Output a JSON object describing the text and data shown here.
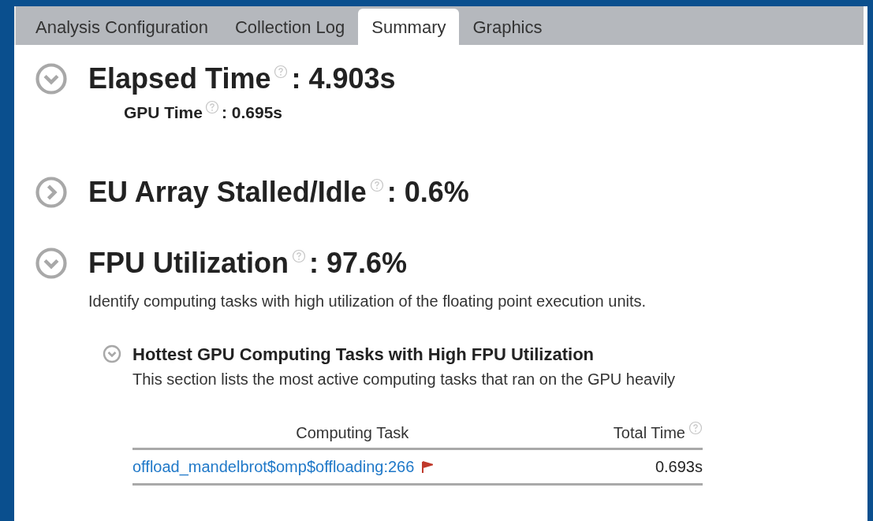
{
  "tabs": [
    {
      "label": "Analysis Configuration",
      "selected": false
    },
    {
      "label": "Collection Log",
      "selected": false
    },
    {
      "label": "Summary",
      "selected": true
    },
    {
      "label": "Graphics",
      "selected": false
    }
  ],
  "sections": [
    {
      "title": "Elapsed Time",
      "value": ": 4.903s",
      "expanded": true,
      "metrics": [
        {
          "label": "GPU Time",
          "value": ": 0.695s"
        }
      ]
    },
    {
      "title": "EU Array Stalled/Idle",
      "value": ": 0.6%",
      "expanded": false
    },
    {
      "title": "FPU Utilization",
      "value": ": 97.6%",
      "expanded": true,
      "description": "Identify computing tasks with high utilization of the floating point execution units.",
      "subsections": [
        {
          "title": "Hottest GPU Computing Tasks with High FPU Utilization",
          "expanded": true,
          "description": "This section lists the most active computing tasks that ran on the GPU heavily",
          "table": {
            "columns": [
              "Computing Task",
              "Total Time"
            ],
            "rows": [
              {
                "task": "offload_mandelbrot$omp$offloading:266",
                "flagged": true,
                "total_time": "0.693s"
              }
            ]
          }
        }
      ]
    }
  ]
}
